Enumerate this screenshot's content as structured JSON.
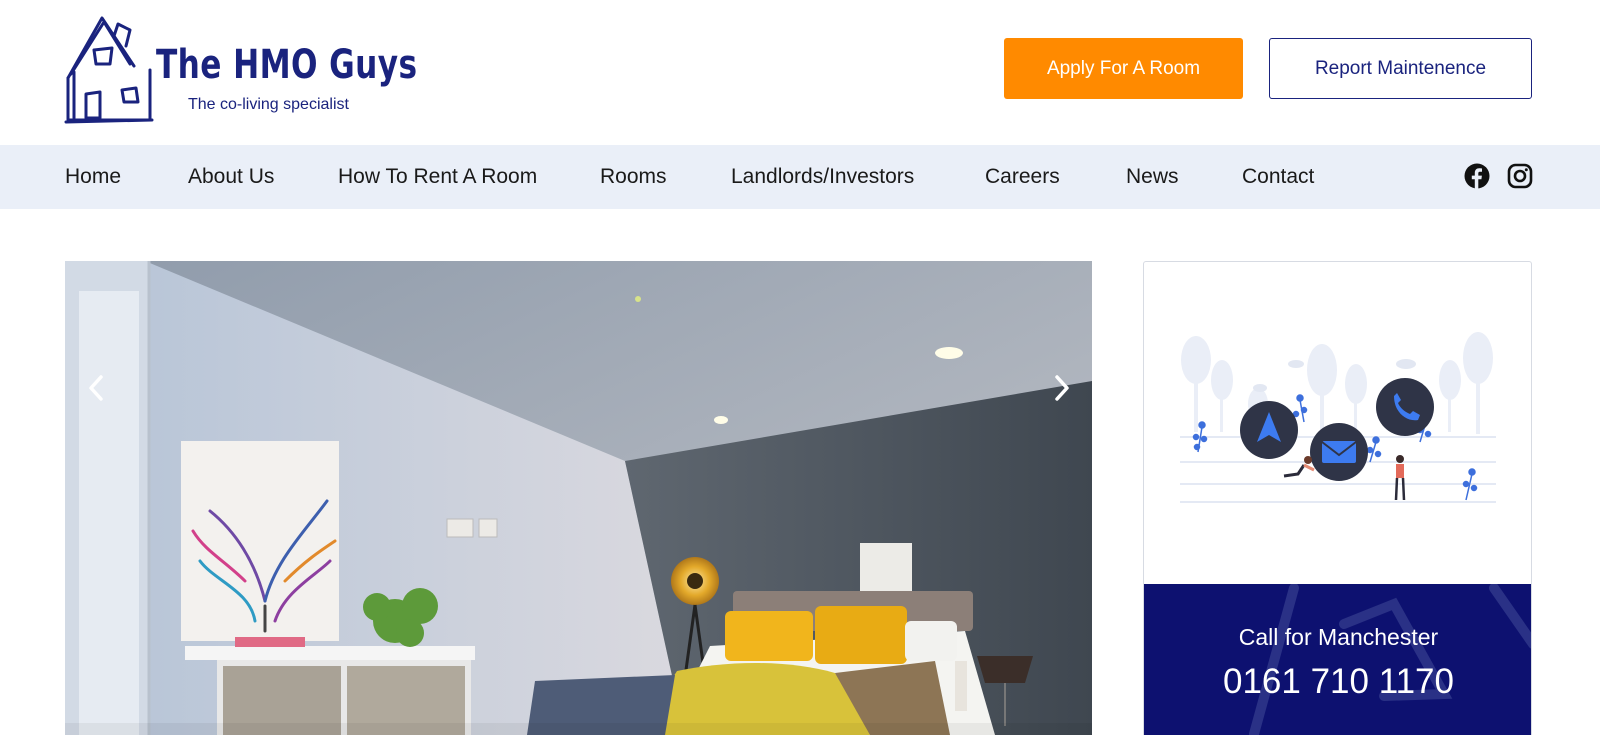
{
  "brand": {
    "title": "The HMO Guys",
    "tagline": "The co-living specialist"
  },
  "header": {
    "apply_label": "Apply For A Room",
    "report_label": "Report Maintenence"
  },
  "nav": {
    "items": [
      {
        "label": "Home"
      },
      {
        "label": "About Us"
      },
      {
        "label": "How To Rent A Room"
      },
      {
        "label": "Rooms"
      },
      {
        "label": "Landlords/Investors"
      },
      {
        "label": "Careers"
      },
      {
        "label": "News"
      },
      {
        "label": "Contact"
      }
    ],
    "social": [
      "facebook-icon",
      "instagram-icon"
    ]
  },
  "slider": {
    "prev_icon": "chevron-left-icon",
    "next_icon": "chevron-right-icon"
  },
  "contact_card": {
    "call_label": "Call for Manchester",
    "phone": "0161 710 1170",
    "icons": [
      "navigation-arrow-icon",
      "envelope-icon",
      "phone-icon"
    ]
  },
  "colors": {
    "brand_navy": "#1a237e",
    "accent_orange": "#ff8a00",
    "nav_bg": "#eaeff8",
    "call_bg": "#0d1170"
  }
}
